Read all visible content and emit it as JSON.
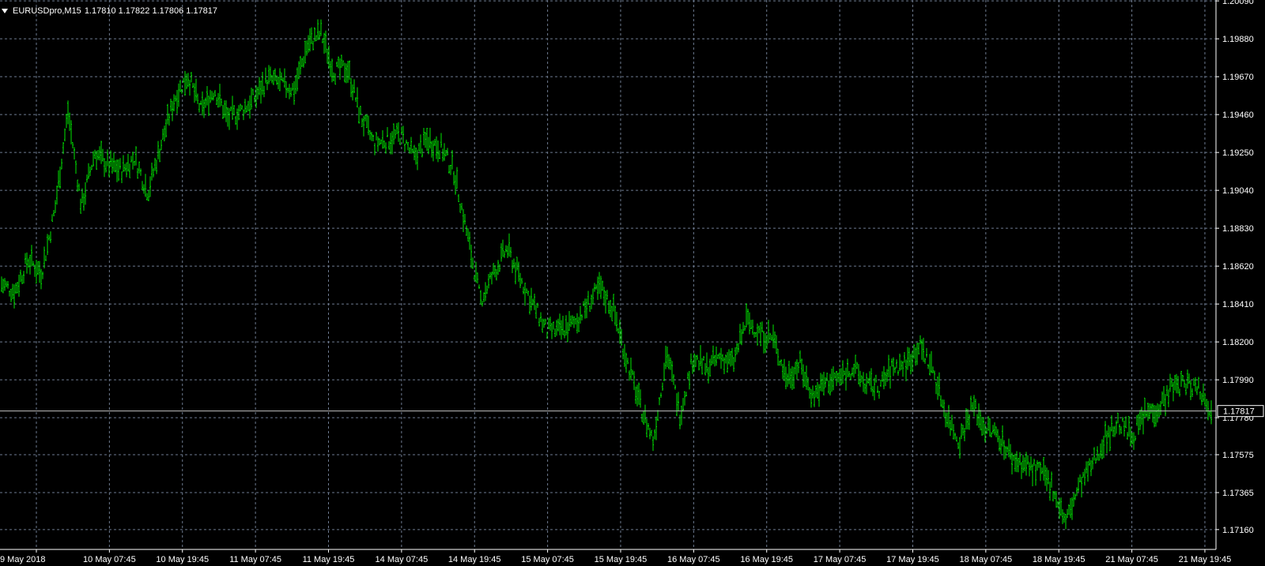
{
  "header": {
    "symbol": "EURUSDpro,M15",
    "ohlc": "1.17810 1.17822 1.17806 1.17817"
  },
  "colors": {
    "background": "#000000",
    "grid": "#6d7a8f",
    "bars": "#00e600",
    "axis": "#ffffff",
    "price_line": "#c0c0c0"
  },
  "chart_data": {
    "type": "ohlc",
    "symbol": "EURUSDpro",
    "timeframe": "M15",
    "grid": true,
    "current_price": 1.17817,
    "current_price_label": "1.17817",
    "ylim": [
      1.1705,
      1.20095
    ],
    "y_ticks": [
      "1.20090",
      "1.19880",
      "1.19670",
      "1.19460",
      "1.19250",
      "1.19040",
      "1.18830",
      "1.18620",
      "1.18410",
      "1.18200",
      "1.17990",
      "1.17780",
      "1.17575",
      "1.17365",
      "1.17160"
    ],
    "x_ticks": [
      "9 May 2018",
      "10 May 07:45",
      "10 May 19:45",
      "11 May 07:45",
      "11 May 19:45",
      "14 May 07:45",
      "14 May 19:45",
      "15 May 07:45",
      "15 May 19:45",
      "16 May 07:45",
      "16 May 19:45",
      "17 May 07:45",
      "17 May 19:45",
      "18 May 07:45",
      "18 May 19:45",
      "21 May 07:45",
      "21 May 19:45"
    ],
    "series": [
      {
        "values": [
          {
            "time": "9 May 2018",
            "close": 1.1852
          },
          {
            "time": "9 May 2018 +3h",
            "close": 1.1848
          },
          {
            "time": "9 May 2018 +6h",
            "close": 1.1866
          },
          {
            "time": "9 May 2018 +9h",
            "close": 1.1858
          },
          {
            "time": "10 May 07:45",
            "close": 1.1893
          },
          {
            "time": "10 May 09:45",
            "close": 1.1948
          },
          {
            "time": "10 May 12:00",
            "close": 1.1895
          },
          {
            "time": "10 May 14:00",
            "close": 1.1925
          },
          {
            "time": "10 May 16:30",
            "close": 1.1918
          },
          {
            "time": "10 May 19:45",
            "close": 1.1915
          },
          {
            "time": "10 May 23:00",
            "close": 1.1922
          },
          {
            "time": "11 May 03:00",
            "close": 1.1903
          },
          {
            "time": "11 May 05:00",
            "close": 1.193
          },
          {
            "time": "11 May 07:45",
            "close": 1.1955
          },
          {
            "time": "11 May 09:30",
            "close": 1.1968
          },
          {
            "time": "11 May 12:00",
            "close": 1.1948
          },
          {
            "time": "11 May 15:00",
            "close": 1.196
          },
          {
            "time": "11 May 17:30",
            "close": 1.1944
          },
          {
            "time": "11 May 19:45",
            "close": 1.1948
          },
          {
            "time": "11 May 23:00",
            "close": 1.1955
          },
          {
            "time": "14 May 02:00",
            "close": 1.1966
          },
          {
            "time": "14 May 04:00",
            "close": 1.1963
          },
          {
            "time": "14 May 05:30",
            "close": 1.196
          },
          {
            "time": "14 May 07:45",
            "close": 1.1985
          },
          {
            "time": "14 May 09:00",
            "close": 1.1991
          },
          {
            "time": "14 May 10:30",
            "close": 1.197
          },
          {
            "time": "14 May 12:30",
            "close": 1.1972
          },
          {
            "time": "14 May 14:30",
            "close": 1.1945
          },
          {
            "time": "14 May 17:00",
            "close": 1.193
          },
          {
            "time": "14 May 19:45",
            "close": 1.1932
          },
          {
            "time": "14 May 22:30",
            "close": 1.1935
          },
          {
            "time": "15 May 01:30",
            "close": 1.1922
          },
          {
            "time": "15 May 03:30",
            "close": 1.1932
          },
          {
            "time": "15 May 05:30",
            "close": 1.1928
          },
          {
            "time": "15 May 07:00",
            "close": 1.1915
          },
          {
            "time": "15 May 08:30",
            "close": 1.188
          },
          {
            "time": "15 May 10:00",
            "close": 1.1843
          },
          {
            "time": "15 May 11:30",
            "close": 1.1858
          },
          {
            "time": "15 May 12:30",
            "close": 1.1872
          },
          {
            "time": "15 May 14:00",
            "close": 1.1855
          },
          {
            "time": "15 May 16:00",
            "close": 1.184
          },
          {
            "time": "15 May 18:00",
            "close": 1.1826
          },
          {
            "time": "15 May 19:45",
            "close": 1.1826
          },
          {
            "time": "15 May 22:00",
            "close": 1.183
          },
          {
            "time": "16 May 01:00",
            "close": 1.184
          },
          {
            "time": "16 May 03:00",
            "close": 1.185
          },
          {
            "time": "16 May 04:30",
            "close": 1.1838
          },
          {
            "time": "16 May 06:00",
            "close": 1.181
          },
          {
            "time": "16 May 07:45",
            "close": 1.1785
          },
          {
            "time": "16 May 09:00",
            "close": 1.1765
          },
          {
            "time": "16 May 10:30",
            "close": 1.1815
          },
          {
            "time": "16 May 12:00",
            "close": 1.178
          },
          {
            "time": "16 May 13:30",
            "close": 1.1812
          },
          {
            "time": "16 May 15:00",
            "close": 1.1805
          },
          {
            "time": "16 May 17:30",
            "close": 1.1812
          },
          {
            "time": "16 May 19:45",
            "close": 1.1808
          },
          {
            "time": "16 May 21:30",
            "close": 1.1832
          },
          {
            "time": "16 May 23:30",
            "close": 1.1825
          },
          {
            "time": "17 May 02:00",
            "close": 1.1822
          },
          {
            "time": "17 May 04:00",
            "close": 1.18
          },
          {
            "time": "17 May 06:00",
            "close": 1.1808
          },
          {
            "time": "17 May 07:45",
            "close": 1.179
          },
          {
            "time": "17 May 09:30",
            "close": 1.1798
          },
          {
            "time": "17 May 11:30",
            "close": 1.18
          },
          {
            "time": "17 May 13:30",
            "close": 1.1806
          },
          {
            "time": "17 May 15:30",
            "close": 1.1796
          },
          {
            "time": "17 May 19:45",
            "close": 1.1795
          },
          {
            "time": "17 May 22:00",
            "close": 1.1806
          },
          {
            "time": "18 May 02:00",
            "close": 1.1808
          },
          {
            "time": "18 May 05:00",
            "close": 1.1818
          },
          {
            "time": "18 May 06:30",
            "close": 1.1805
          },
          {
            "time": "18 May 07:45",
            "close": 1.178
          },
          {
            "time": "18 May 09:30",
            "close": 1.1765
          },
          {
            "time": "18 May 11:00",
            "close": 1.1785
          },
          {
            "time": "18 May 13:00",
            "close": 1.1772
          },
          {
            "time": "18 May 15:30",
            "close": 1.1768
          },
          {
            "time": "18 May 18:00",
            "close": 1.1755
          },
          {
            "time": "18 May 19:45",
            "close": 1.1752
          },
          {
            "time": "18 May 22:00",
            "close": 1.1748
          },
          {
            "time": "21 May 02:00",
            "close": 1.174
          },
          {
            "time": "21 May 04:00",
            "close": 1.172
          },
          {
            "time": "21 May 06:00",
            "close": 1.174
          },
          {
            "time": "21 May 07:45",
            "close": 1.1752
          },
          {
            "time": "21 May 09:30",
            "close": 1.1768
          },
          {
            "time": "21 May 11:00",
            "close": 1.1775
          },
          {
            "time": "21 May 12:30",
            "close": 1.1768
          },
          {
            "time": "21 May 14:30",
            "close": 1.178
          },
          {
            "time": "21 May 16:30",
            "close": 1.1784
          },
          {
            "time": "21 May 17:30",
            "close": 1.1795
          },
          {
            "time": "21 May 18:30",
            "close": 1.1797
          },
          {
            "time": "21 May 19:45",
            "close": 1.1795
          },
          {
            "time": "21 May 20:45",
            "close": 1.1782
          }
        ]
      }
    ]
  }
}
